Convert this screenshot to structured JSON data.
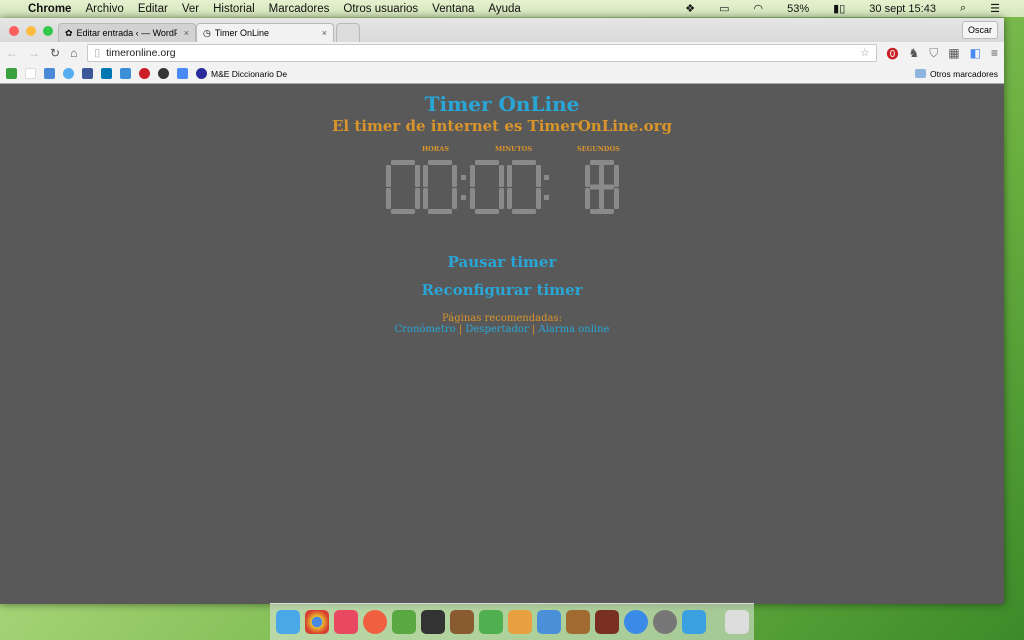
{
  "menubar": {
    "app": "Chrome",
    "items": [
      "Archivo",
      "Editar",
      "Ver",
      "Historial",
      "Marcadores",
      "Otros usuarios",
      "Ventana",
      "Ayuda"
    ],
    "battery": "53%",
    "datetime": "30 sept 15:43"
  },
  "browser": {
    "tabs": [
      {
        "label": "Editar entrada ‹ — WordPress",
        "active": false
      },
      {
        "label": "Timer OnLine",
        "active": true
      }
    ],
    "profile": "Oscar",
    "url": "timeronline.org",
    "bookmarks": {
      "item": "M&E Diccionario De",
      "other": "Otros marcadores"
    }
  },
  "page": {
    "title": "Timer OnLine",
    "subtitle": "El timer de internet es TimerOnLine.org",
    "labels": {
      "hours": "HORAS",
      "minutes": "MINUTOS",
      "seconds": "SEGUNDOS"
    },
    "time": {
      "hours": "00",
      "minutes": "00",
      "seconds": "18"
    },
    "pause": "Pausar timer",
    "reset": "Reconfigurar timer",
    "recommended": "Páginas recomendadas:",
    "links": [
      "Cronómetro",
      "Despertador",
      "Alarma online"
    ],
    "colors": {
      "accent": "#29a6d6",
      "orange": "#d9952c",
      "background": "#595959",
      "digits": "#8a8a8a"
    }
  }
}
